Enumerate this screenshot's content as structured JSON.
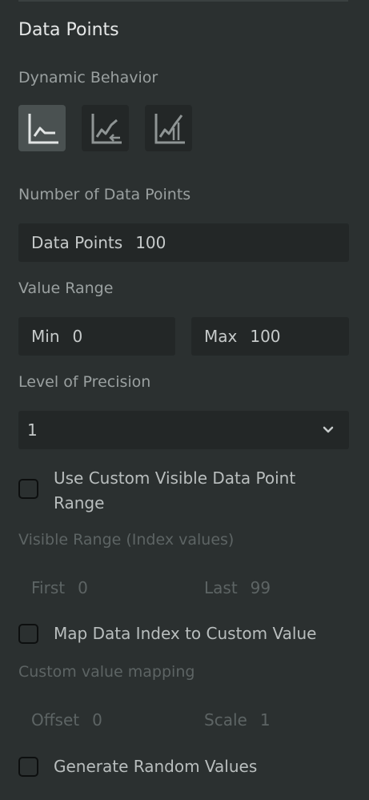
{
  "section": {
    "title": "Data Points"
  },
  "dynamic_behavior": {
    "label": "Dynamic Behavior",
    "options": [
      {
        "icon": "line-chart-icon",
        "active": true
      },
      {
        "icon": "line-chart-arrow-left-icon",
        "active": false
      },
      {
        "icon": "line-chart-bars-icon",
        "active": false
      }
    ]
  },
  "num_points": {
    "label": "Number of Data Points",
    "field_label": "Data Points",
    "value": "100"
  },
  "value_range": {
    "label": "Value Range",
    "min_label": "Min",
    "min_value": "0",
    "max_label": "Max",
    "max_value": "100"
  },
  "precision": {
    "label": "Level of Precision",
    "selected": "1"
  },
  "custom_visible_range": {
    "checkbox_label": "Use Custom Visible Data Point Range",
    "checked": false,
    "section_label": "Visible Range (Index values)",
    "first_label": "First",
    "first_value": "0",
    "last_label": "Last",
    "last_value": "99"
  },
  "map_index": {
    "checkbox_label": "Map Data Index to Custom Value",
    "checked": false,
    "section_label": "Custom value mapping",
    "offset_label": "Offset",
    "offset_value": "0",
    "scale_label": "Scale",
    "scale_value": "1"
  },
  "random_values": {
    "checkbox_label": "Generate Random Values",
    "checked": false
  },
  "colors": {
    "background": "#2b3030",
    "field_bg": "#232727",
    "active_btn": "#4a5151"
  }
}
